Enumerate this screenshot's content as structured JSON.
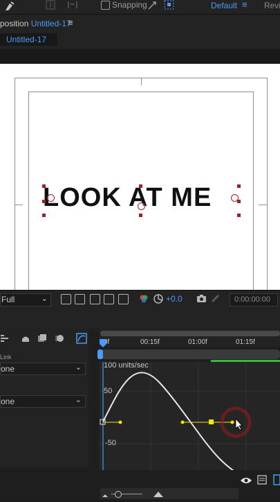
{
  "toolbar": {
    "snapping_label": "Snapping",
    "workspace_active": "Default",
    "workspace_menu_icon": "hamburger-icon",
    "workspace_next": "Revie"
  },
  "composition": {
    "label_prefix": "position",
    "name": "Untitled-17",
    "menu_icon": "hamburger-icon",
    "tab_label": "Untitled-17"
  },
  "canvas": {
    "text_layer": "LOOK AT ME",
    "background": "#ffffff",
    "handle_color": "#a0202a"
  },
  "viewer_controls": {
    "resolution": "Full",
    "exposure": "+0.0",
    "timecode": "0:00:00:00"
  },
  "timeline": {
    "ruler_labels": [
      "0f",
      "00:15f",
      "01:00f",
      "01:15f"
    ],
    "left_panel": {
      "parent_link_label": "Link",
      "select_1": "one",
      "select_2": "one"
    },
    "graph": {
      "units_label": "100 units/sec",
      "label_50": "50",
      "label_minus_50": "-50",
      "curve_color": "#e6e6e6",
      "keyframe_color": "#f2e600"
    }
  },
  "colors": {
    "accent": "#4a9bf5",
    "panel": "#232323",
    "work_area_bar": "#2fbd3a"
  }
}
